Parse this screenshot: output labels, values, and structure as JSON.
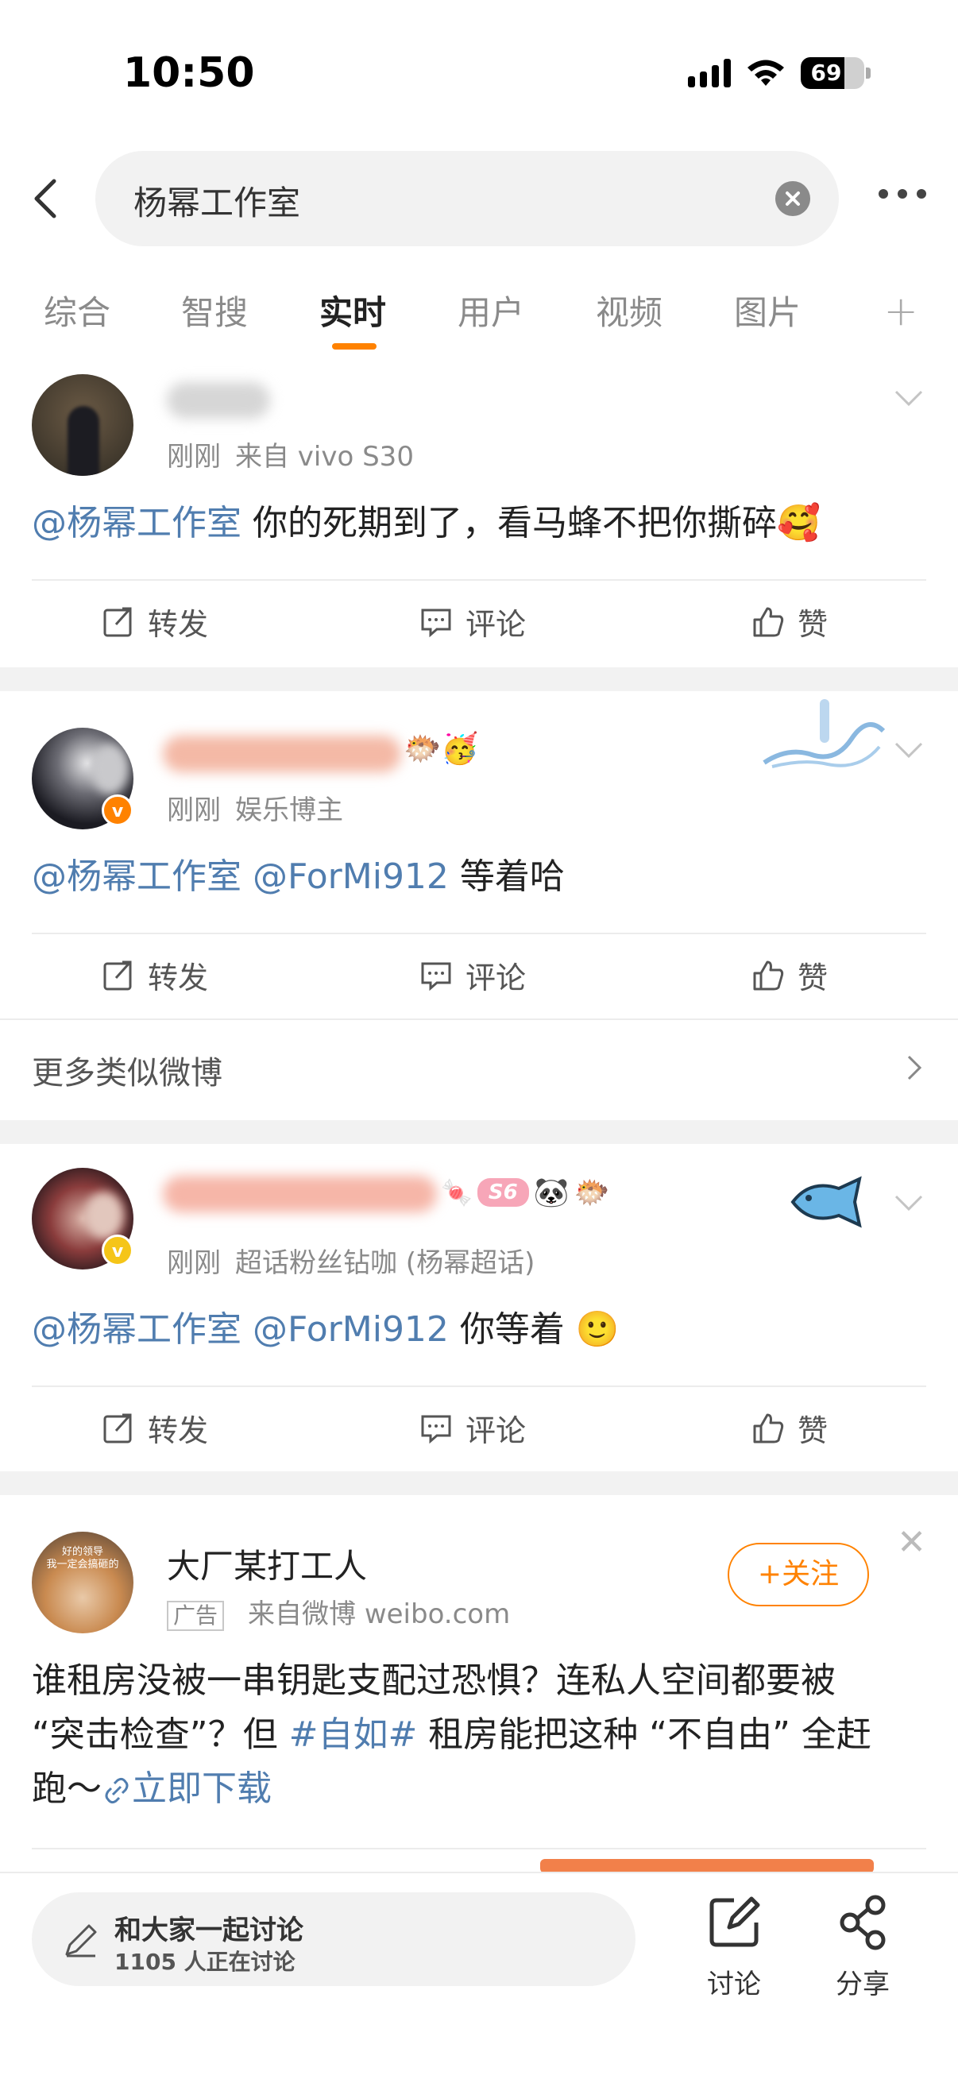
{
  "status": {
    "time": "10:50",
    "battery": "69",
    "battery_level": 0.69
  },
  "search": {
    "query": "杨幂工作室"
  },
  "tabs": [
    {
      "label": "综合"
    },
    {
      "label": "智搜"
    },
    {
      "label": "实时",
      "active": true
    },
    {
      "label": "用户"
    },
    {
      "label": "视频"
    },
    {
      "label": "图片"
    }
  ],
  "posts": [
    {
      "time": "刚刚",
      "source": "来自 vivo S30",
      "mention": "@杨幂工作室",
      "text": " 你的死期到了，看马蜂不把你撕碎",
      "emoji": "🥰"
    },
    {
      "time": "刚刚",
      "source": "娱乐博主",
      "mention": "@杨幂工作室",
      "mention2": "@ForMi912",
      "text": " 等着哈"
    },
    {
      "time": "刚刚",
      "source": "超话粉丝钻咖 (杨幂超话)",
      "badge": "S6",
      "mention": "@杨幂工作室",
      "mention2": "@ForMi912",
      "text": " 你等着",
      "emoji": "🙂"
    }
  ],
  "actions": {
    "repost": "转发",
    "comment": "评论",
    "like": "赞"
  },
  "more_similar": "更多类似微博",
  "ad": {
    "author": "大厂某打工人",
    "tag": "广告",
    "source": "来自微博 weibo.com",
    "follow": "+关注",
    "avatar_caption_1": "好的领导",
    "avatar_caption_2": "我一定会搞砸的",
    "text_line1": "谁租房没被一串钥匙支配过恐惧？连私人空间都要被",
    "text_line2a": "“突击检查”？但 ",
    "hashtag": "#自如#",
    "text_line2b": " 租房能把这种 “不自由” 全赶",
    "text_line3": "跑～",
    "download": "立即下载"
  },
  "bottom": {
    "discuss_title": "和大家一起讨论",
    "discuss_sub": "1105 人正在讨论",
    "discuss_btn": "讨论",
    "share_btn": "分享"
  },
  "colors": {
    "accent": "#ff8200",
    "link": "#507daf"
  }
}
